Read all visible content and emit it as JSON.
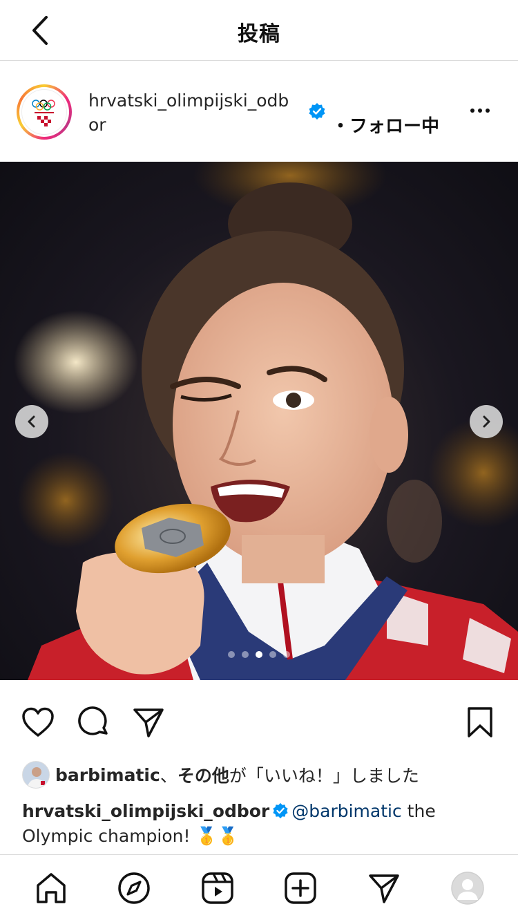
{
  "header": {
    "title": "投稿"
  },
  "post": {
    "username_line1": "hrvatski_olimpijski_odb",
    "username_line2": "or",
    "follow_status": "・フォロー中",
    "carousel_total": 5,
    "carousel_active_index": 2,
    "icons": [
      "back-icon",
      "verified-icon",
      "more-icon",
      "carousel-prev-icon",
      "carousel-next-icon"
    ]
  },
  "actions": {
    "icons": [
      "heart-icon",
      "comment-icon",
      "share-icon",
      "bookmark-icon"
    ]
  },
  "likes": {
    "first_liker": "barbimatic",
    "separator": "、",
    "others": "その他",
    "suffix": "が「いいね！」しました"
  },
  "caption": {
    "username": "hrvatski_olimpijski_odbor",
    "mention": "@barbimatic",
    "text": " the Olympic champion! ",
    "emoji": "🥇🥇"
  },
  "bottom_nav": {
    "icons": [
      "home-icon",
      "explore-icon",
      "reels-icon",
      "create-icon",
      "messages-icon",
      "profile-avatar-icon"
    ]
  },
  "colors": {
    "verified": "#0095f6",
    "mention": "#00376b",
    "divider": "#dbdbdb"
  }
}
